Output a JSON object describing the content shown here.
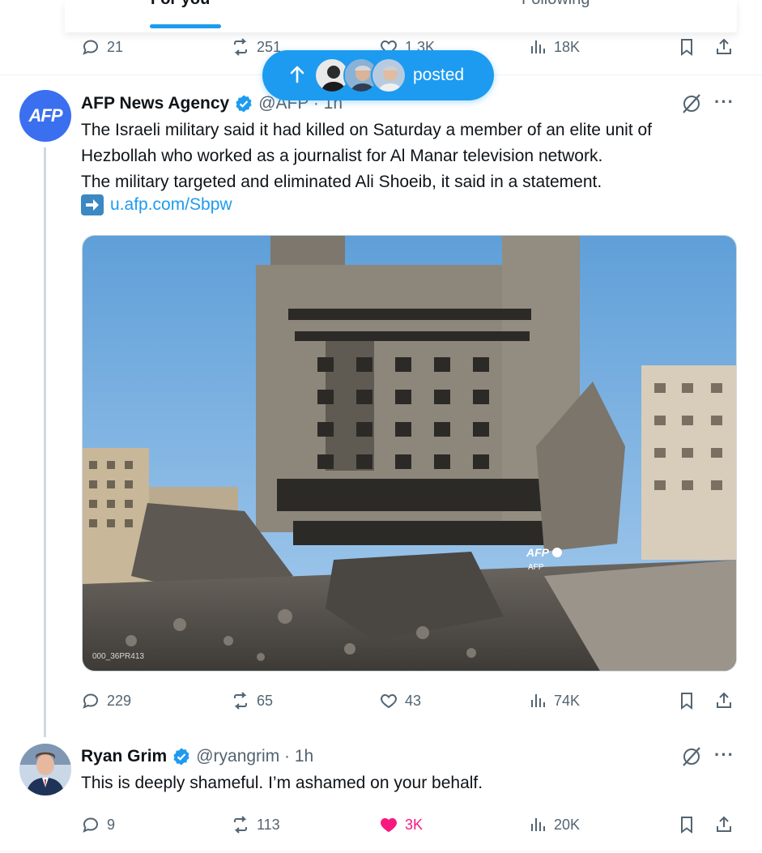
{
  "tabs": {
    "for_you": "For you",
    "following": "Following"
  },
  "prev_tweet": {
    "replies": "21",
    "reposts": "251",
    "likes": "1.3K",
    "views": "18K"
  },
  "new_posts_pill": {
    "label": "posted"
  },
  "tweet_afp": {
    "avatar_text": "AFP",
    "name": "AFP News Agency",
    "handle": "@AFP · 1h",
    "lines": [
      "The Israeli military said it had killed on Saturday a member of an elite unit of",
      "Hezbollah who worked as a journalist for Al Manar television network.",
      "The military targeted and eliminated Ali Shoeib, it said in a statement."
    ],
    "link": "u.afp.com/Sbpw",
    "media_watermark": "AFP",
    "media_watermark_sub": "AFP",
    "media_caption": "000_36PR413",
    "replies": "229",
    "reposts": "65",
    "likes": "43",
    "views": "74K"
  },
  "tweet_ryan": {
    "name": "Ryan Grim",
    "handle": "@ryangrim · 1h",
    "text": "This is deeply shameful. I’m ashamed on your behalf.",
    "replies": "9",
    "reposts": "113",
    "likes": "3K",
    "views": "20K"
  },
  "colors": {
    "accent": "#1d9bf0",
    "like": "#f91880",
    "muted": "#536471",
    "verified": "#1d9bf0"
  },
  "icons": [
    "reply-icon",
    "repost-icon",
    "like-icon",
    "views-icon",
    "bookmark-icon",
    "share-icon",
    "grok-icon",
    "more-icon",
    "verified-icon",
    "arrow-up-icon"
  ]
}
